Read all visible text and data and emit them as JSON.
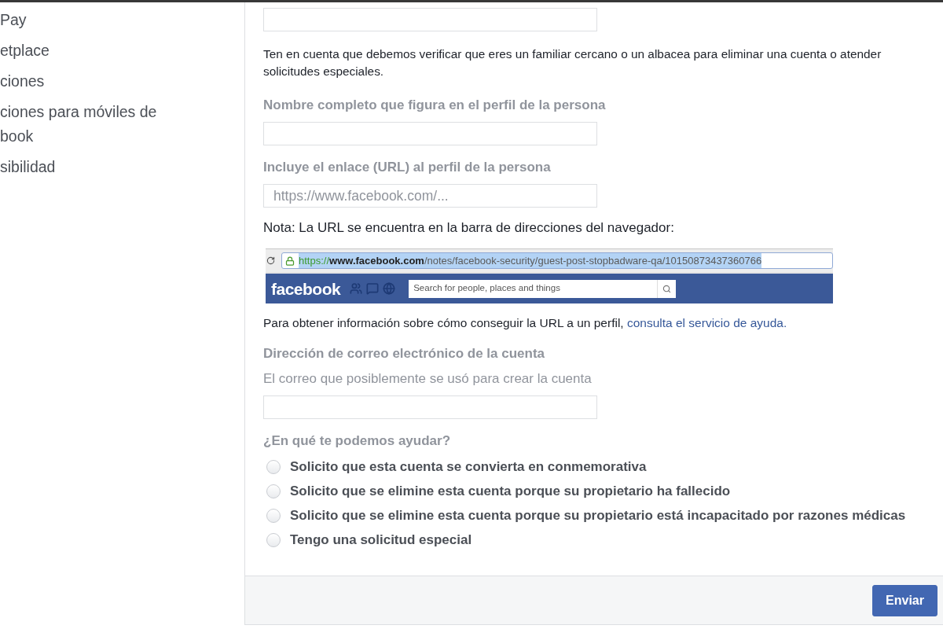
{
  "sidebar": {
    "items": [
      {
        "label": "Pay"
      },
      {
        "label": "etplace"
      },
      {
        "label": "ciones"
      },
      {
        "label": "ciones para móviles de book"
      },
      {
        "label": "sibilidad"
      }
    ]
  },
  "form": {
    "sections": [
      {
        "kind": "input"
      },
      {
        "kind": "notice",
        "text": "Ten en cuenta que debemos verificar que eres un familiar cercano o un albacea para eliminar una cuenta o atender solicitudes especiales."
      },
      {
        "kind": "label",
        "text": "Nombre completo que figura en el perfil de la persona"
      },
      {
        "kind": "input"
      },
      {
        "kind": "label",
        "text": "Incluye el enlace (URL) al perfil de la persona"
      },
      {
        "kind": "input",
        "placeholder": "https://www.facebook.com/..."
      },
      {
        "kind": "instruction",
        "text": "Nota: La URL se encuentra en la barra de direcciones del navegador:"
      },
      {
        "kind": "browser_screenshot",
        "url": {
          "scheme": "https://",
          "host": "www.facebook.com",
          "path": "/notes/facebook-security/guest-post-stopbadware-qa/10150873437360766",
          "highlighted": true
        },
        "logo": "facebook",
        "search_placeholder": "Search for people, places and things"
      },
      {
        "kind": "help_text",
        "text": "Para obtener información sobre cómo conseguir la URL a un perfil,",
        "link": "consulta el servicio de ayuda."
      },
      {
        "kind": "label",
        "text": "Dirección de correo electrónico de la cuenta"
      },
      {
        "kind": "hint",
        "text": "El correo que posiblemente se usó para crear la cuenta"
      },
      {
        "kind": "input"
      },
      {
        "kind": "label",
        "text": "¿En qué te podemos ayudar?"
      },
      {
        "kind": "radio_group",
        "options": [
          {
            "label": "Solicito que esta cuenta se convierta en conmemorativa",
            "selected": false
          },
          {
            "label": "Solicito que se elimine esta cuenta porque su propietario ha fallecido",
            "selected": false
          },
          {
            "label": "Solicito que se elimine esta cuenta porque su propietario está incapacitado por razones médicas",
            "selected": false
          },
          {
            "label": "Tengo una solicitud especial",
            "selected": false
          }
        ]
      }
    ]
  },
  "footer": {
    "buttons": [
      "Enviar"
    ]
  }
}
